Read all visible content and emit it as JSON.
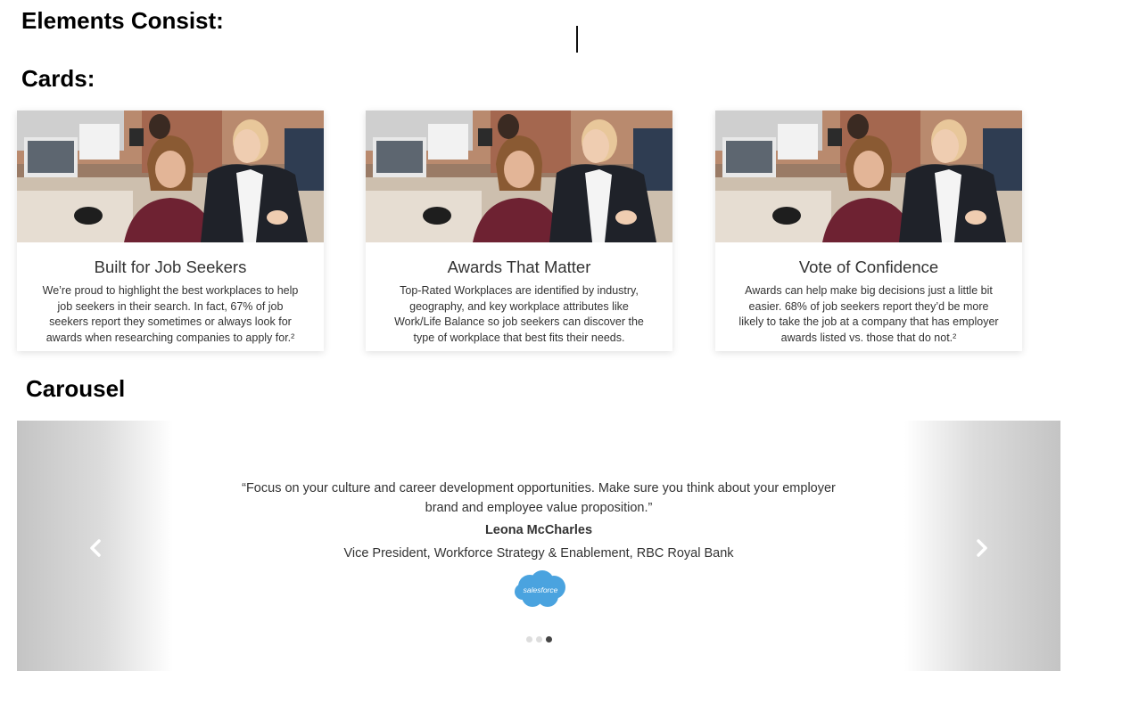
{
  "headings": {
    "elements": "Elements Consist:",
    "cards": "Cards:",
    "carousel": "Carousel"
  },
  "cards": [
    {
      "title": "Built for Job Seekers",
      "body": "We’re proud to highlight the best workplaces to help job seekers in their search. In fact, 67% of job seekers report they sometimes or always look for awards when researching companies to apply for.²"
    },
    {
      "title": "Awards That Matter",
      "body": "Top-Rated Workplaces are identified by industry, geography, and key workplace attributes like Work/Life Balance so job seekers can discover the type of workplace that best fits their needs."
    },
    {
      "title": "Vote of Confidence",
      "body": "Awards can help make big decisions just a little bit easier. 68% of job seekers report they’d be more likely to take the job at a company that has employer awards listed vs. those that do not.²"
    }
  ],
  "carousel": {
    "quote": "“Focus on your culture and career development opportunities. Make sure you think about your employer brand and employee value proposition.”",
    "author": "Leona McCharles",
    "role": "Vice President, Workforce Strategy & Enablement, RBC Royal Bank",
    "logo_text": "salesforce",
    "logo_color": "#4aa3df",
    "prev_icon": "chevron-left-icon",
    "next_icon": "chevron-right-icon",
    "slide_count": 3,
    "active_slide": 3
  }
}
